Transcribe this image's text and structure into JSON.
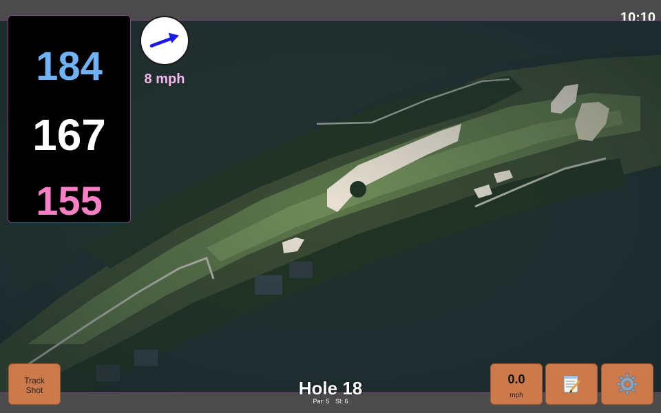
{
  "status_bar": {
    "time": "10:10"
  },
  "distances": {
    "back": "184",
    "middle": "167",
    "front": "155"
  },
  "wind": {
    "speed": "8 mph",
    "icon": "wind-arrow-icon"
  },
  "hole": {
    "title": "Hole 18",
    "par": "Par: 5",
    "stroke_index": "SI: 6"
  },
  "buttons": {
    "track_shot": [
      "Track",
      "Shot"
    ],
    "speed_value": "0.0",
    "speed_unit": "mph",
    "notes_icon": "notepad-icon",
    "settings_icon": "gear-icon"
  },
  "colors": {
    "back_distance": "#6fb2f5",
    "middle_distance": "#ffffff",
    "front_distance": "#f77fc6",
    "wind_text": "#f3b7ee",
    "button": "#cc7a4b",
    "panel_border": "#8a3d8a"
  }
}
